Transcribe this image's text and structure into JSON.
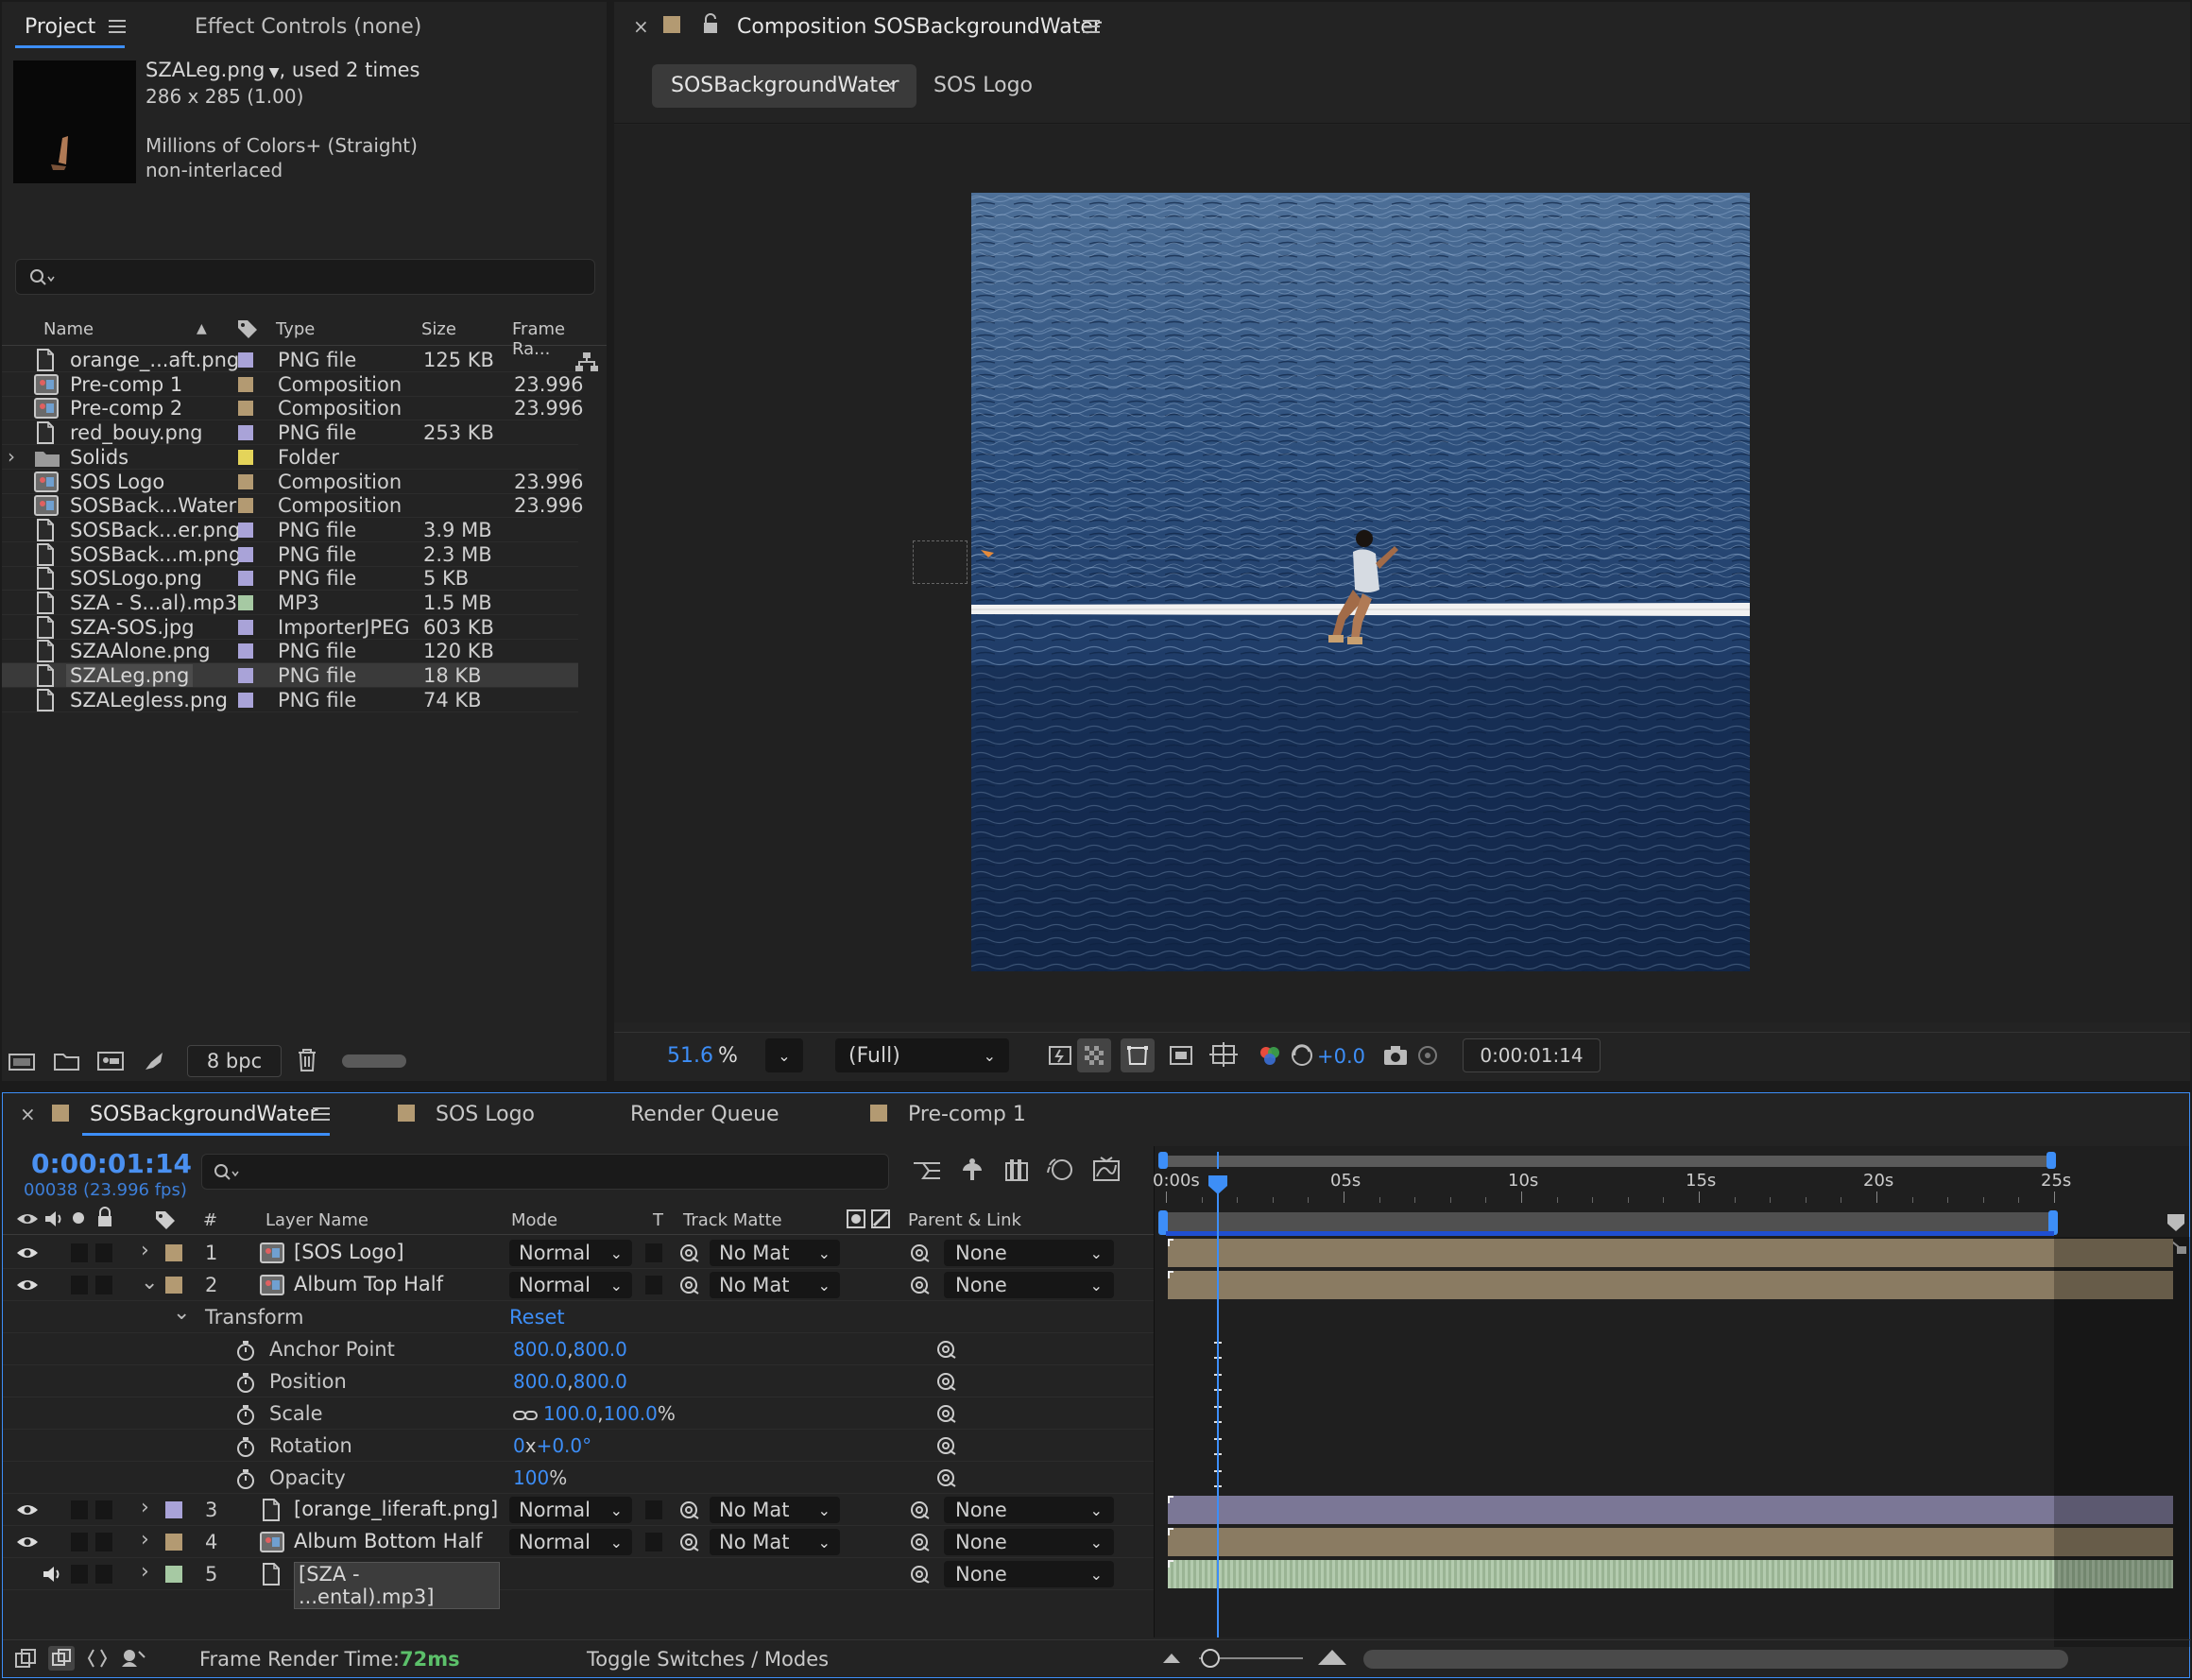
{
  "project_panel": {
    "tab_project": "Project",
    "tab_effect_controls": "Effect Controls (none)",
    "selected_file": "SZALeg.png",
    "used_times": ", used 2 times",
    "dimensions": "286 x 285 (1.00)",
    "colors": "Millions of Colors+ (Straight)",
    "interlace": "non-interlaced",
    "columns": {
      "name": "Name",
      "type": "Type",
      "size": "Size",
      "frame_rate": "Frame Ra..."
    },
    "items": [
      {
        "name": "orange_...aft.png",
        "type": "PNG file",
        "size": "125 KB",
        "fps": "",
        "icon": "file",
        "color": "#a9a3d8"
      },
      {
        "name": "Pre-comp 1",
        "type": "Composition",
        "size": "",
        "fps": "23.996",
        "icon": "comp",
        "color": "#b39a72"
      },
      {
        "name": "Pre-comp 2",
        "type": "Composition",
        "size": "",
        "fps": "23.996",
        "icon": "comp",
        "color": "#b39a72"
      },
      {
        "name": "red_bouy.png",
        "type": "PNG file",
        "size": "253 KB",
        "fps": "",
        "icon": "file",
        "color": "#a9a3d8"
      },
      {
        "name": "Solids",
        "type": "Folder",
        "size": "",
        "fps": "",
        "icon": "folder",
        "color": "#e4d45a"
      },
      {
        "name": "SOS Logo",
        "type": "Composition",
        "size": "",
        "fps": "23.996",
        "icon": "comp",
        "color": "#b39a72"
      },
      {
        "name": "SOSBack...Water",
        "type": "Composition",
        "size": "",
        "fps": "23.996",
        "icon": "comp",
        "color": "#b39a72"
      },
      {
        "name": "SOSBack...er.png",
        "type": "PNG file",
        "size": "3.9 MB",
        "fps": "",
        "icon": "file",
        "color": "#a9a3d8"
      },
      {
        "name": "SOSBack...m.png",
        "type": "PNG file",
        "size": "2.3 MB",
        "fps": "",
        "icon": "file",
        "color": "#a9a3d8"
      },
      {
        "name": "SOSLogo.png",
        "type": "PNG file",
        "size": "5 KB",
        "fps": "",
        "icon": "file",
        "color": "#a9a3d8"
      },
      {
        "name": "SZA - S...al).mp3",
        "type": "MP3",
        "size": "1.5 MB",
        "fps": "",
        "icon": "file",
        "color": "#a6c9a3"
      },
      {
        "name": "SZA-SOS.jpg",
        "type": "ImporterJPEG",
        "size": "603 KB",
        "fps": "",
        "icon": "file",
        "color": "#a9a3d8"
      },
      {
        "name": "SZAAlone.png",
        "type": "PNG file",
        "size": "120 KB",
        "fps": "",
        "icon": "file",
        "color": "#a9a3d8"
      },
      {
        "name": "SZALeg.png",
        "type": "PNG file",
        "size": "18 KB",
        "fps": "",
        "icon": "file",
        "color": "#a9a3d8",
        "selected": true
      },
      {
        "name": "SZALegless.png",
        "type": "PNG file",
        "size": "74 KB",
        "fps": "",
        "icon": "file",
        "color": "#a9a3d8"
      }
    ],
    "bpc": "8 bpc"
  },
  "composition_panel": {
    "title": "Composition SOSBackgroundWater",
    "crumb_active": "SOSBackgroundWater",
    "crumb_other": "SOS Logo",
    "zoom": "51.6",
    "zoom_unit": "%",
    "resolution": "(Full)",
    "exposure": "+0.0",
    "timecode": "0:00:01:14"
  },
  "timeline": {
    "tabs": [
      "SOSBackgroundWater",
      "SOS Logo",
      "Render Queue",
      "Pre-comp 1"
    ],
    "current_time": "0:00:01:14",
    "frame_info": "00038 (23.996 fps)",
    "col_num": "#",
    "col_layer_name": "Layer Name",
    "col_mode": "Mode",
    "col_t": "T",
    "col_track_matte": "Track Matte",
    "col_parent": "Parent & Link",
    "ruler": [
      "0:00s",
      "05s",
      "10s",
      "15s",
      "20s",
      "25s"
    ],
    "layers": [
      {
        "num": "1",
        "name": "[SOS Logo]",
        "mode": "Normal",
        "matte": "No Mat",
        "parent": "None",
        "color": "#b39a72",
        "icon": "comp",
        "expanded": false
      },
      {
        "num": "2",
        "name": "Album Top Half",
        "mode": "Normal",
        "matte": "No Mat",
        "parent": "None",
        "color": "#b39a72",
        "icon": "comp",
        "expanded": true
      },
      {
        "num": "3",
        "name": "[orange_liferaft.png]",
        "mode": "Normal",
        "matte": "No Mat",
        "parent": "None",
        "color": "#a9a3d8",
        "icon": "file",
        "expanded": false
      },
      {
        "num": "4",
        "name": "Album Bottom Half",
        "mode": "Normal",
        "matte": "No Mat",
        "parent": "None",
        "color": "#b39a72",
        "icon": "comp",
        "expanded": false
      },
      {
        "num": "5",
        "name": "[SZA - ...ental).mp3]",
        "mode": "",
        "matte": "",
        "parent": "None",
        "color": "#a6c9a3",
        "icon": "file",
        "expanded": false
      }
    ],
    "transform": {
      "label": "Transform",
      "reset": "Reset",
      "anchor_label": "Anchor Point",
      "anchor_x": "800.0",
      "anchor_y": "800.0",
      "position_label": "Position",
      "position_x": "800.0",
      "position_y": "800.0",
      "scale_label": "Scale",
      "scale_x": "100.0",
      "scale_y": "100.0",
      "scale_unit": "%",
      "rotation_label": "Rotation",
      "rotation_rev": "0",
      "rotation_x": "x",
      "rotation_deg": "+0.0°",
      "opacity_label": "Opacity",
      "opacity_value": "100",
      "opacity_unit": "%"
    },
    "frame_render_label": "Frame Render Time:",
    "frame_render_value": "72ms",
    "toggle_label": "Toggle Switches / Modes"
  }
}
